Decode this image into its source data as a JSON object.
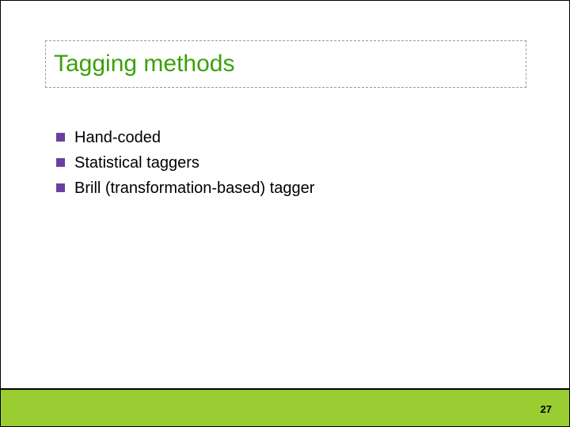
{
  "slide": {
    "title": "Tagging methods",
    "bullets": [
      "Hand-coded",
      "Statistical taggers",
      "Brill (transformation-based) tagger"
    ],
    "page_number": "27"
  }
}
